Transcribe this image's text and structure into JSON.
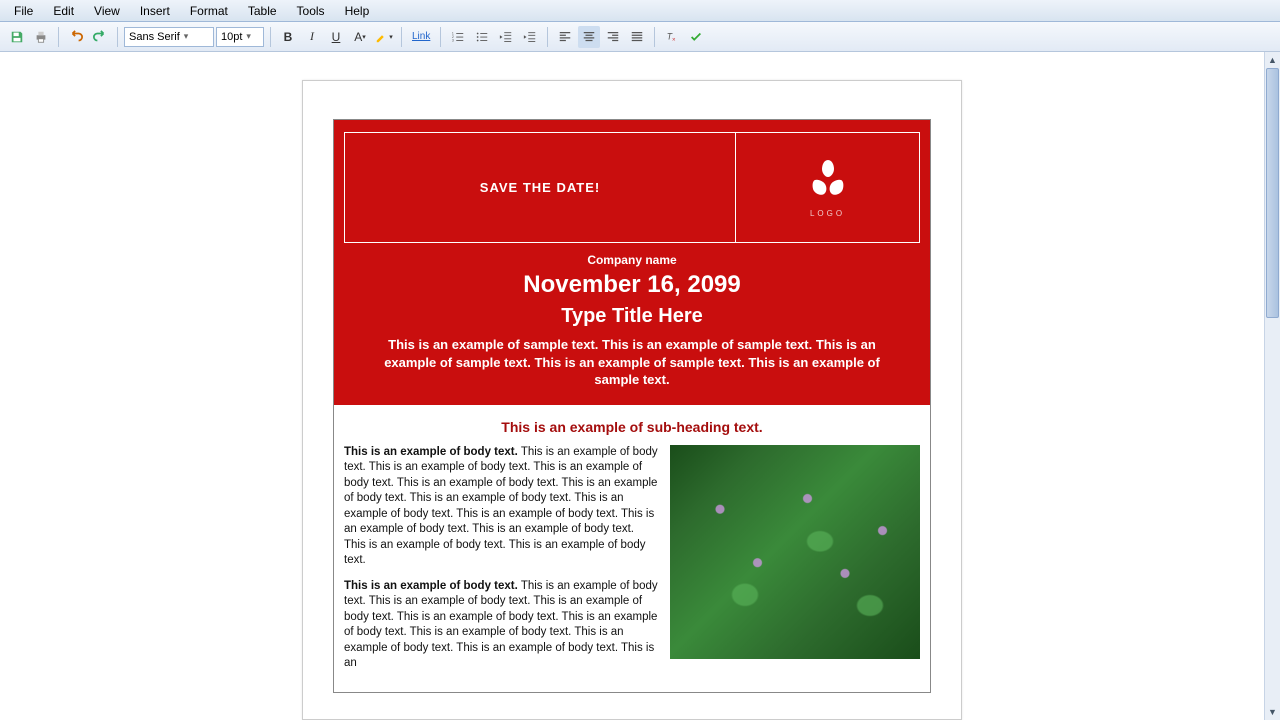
{
  "menu": {
    "items": [
      "File",
      "Edit",
      "View",
      "Insert",
      "Format",
      "Table",
      "Tools",
      "Help"
    ]
  },
  "toolbar": {
    "font_family": "Sans Serif",
    "font_size": "10pt",
    "link_label": "Link"
  },
  "doc": {
    "header_banner": "SAVE THE DATE!",
    "logo_label": "LOGO",
    "company": "Company name",
    "date": "November 16, 2099",
    "title": "Type Title Here",
    "intro": "This is an example of sample text. This is an example of sample text. This is an example of sample text. This is an example of sample text. This is an example of sample text.",
    "subheading": "This is an example of sub-heading text.",
    "body1_lead": "This is an example of body text.",
    "body1_rest": " This is an example of body text. This is an example of body text. This is an example of body text. This is an example of body text. This is an example of body text. This is an example of body text. This is an example of body text. This is an example of body text. This is an example of body text. This is an example of body text. This is an example of body text. This is an example of body text.",
    "body2_lead": "This is an example of body text.",
    "body2_rest": " This is an example of body text. This is an example of body text. This is an example of body text. This is an example of body text. This is an example of body text. This is an example of body text. This is an example of body text. This is an example of body text. This is an"
  }
}
